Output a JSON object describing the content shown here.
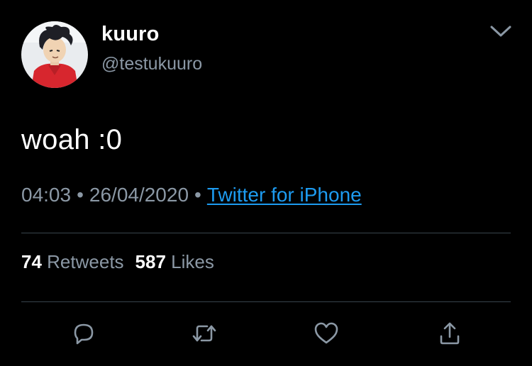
{
  "user": {
    "display_name": "kuuro",
    "handle": "@testukuuro"
  },
  "tweet": {
    "text": "woah :0",
    "time": "04:03",
    "date": "26/04/2020",
    "separator": "•",
    "source": "Twitter for iPhone"
  },
  "stats": {
    "retweets_count": "74",
    "retweets_label": "Retweets",
    "likes_count": "587",
    "likes_label": "Likes"
  },
  "actions": {
    "reply_icon": "reply-icon",
    "retweet_icon": "retweet-icon",
    "like_icon": "heart-icon",
    "share_icon": "share-icon"
  },
  "colors": {
    "background": "#000000",
    "text": "#ffffff",
    "secondary": "#8b98a5",
    "link": "#1d9bf0",
    "divider": "#38444d"
  }
}
